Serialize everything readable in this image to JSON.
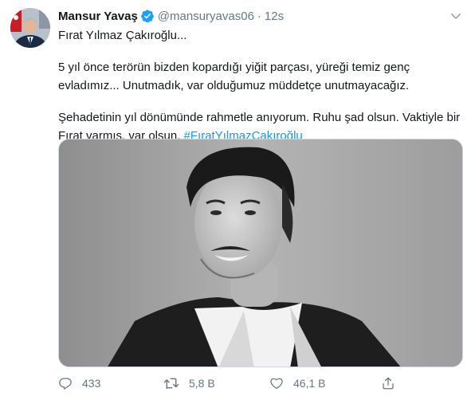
{
  "tweet": {
    "author_name": "Mansur Yavaş",
    "handle": "@mansuryavas06",
    "separator": "·",
    "time": "12s",
    "paragraphs": [
      "Fırat Yılmaz Çakıroğlu...",
      "5 yıl önce terörün bizden kopardığı yiğit parçası, yüreği temiz genç evladımız... Unutmadık, var olduğumuz müddetçe unutmayacağız.",
      "Şehadetinin yıl dönümünde rahmetle anıyorum. Ruhu şad olsun. Vaktiyle bir Fırat varmış, var olsun."
    ],
    "hashtag": "#FıratYılmazÇakıroğlu",
    "counts": {
      "replies": "433",
      "retweets": "5,8 B",
      "likes": "46,1 B"
    }
  },
  "icons": {
    "verified": "verified-badge-icon",
    "caret": "chevron-down-icon",
    "reply": "reply-icon",
    "retweet": "retweet-icon",
    "like": "heart-icon",
    "share": "share-icon"
  },
  "colors": {
    "text": "#14171a",
    "secondary": "#657786",
    "link": "#1b95e0",
    "verified": "#1da1f2"
  }
}
